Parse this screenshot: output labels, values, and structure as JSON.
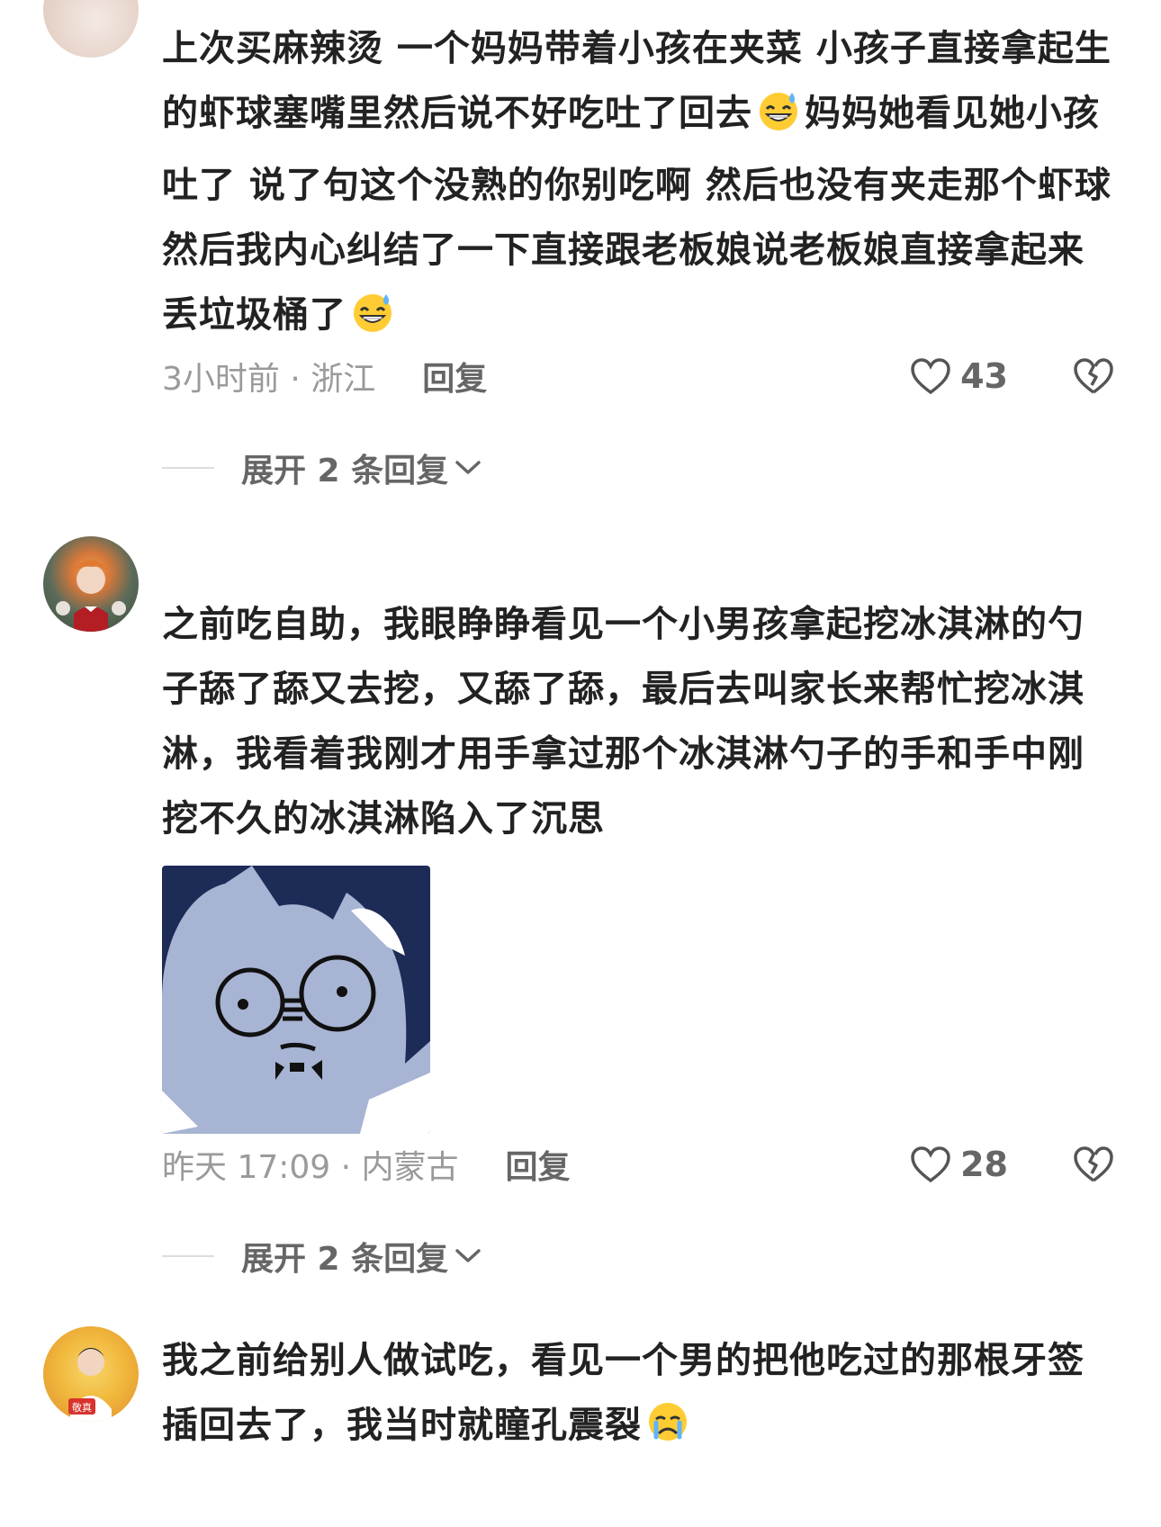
{
  "comments": [
    {
      "text_parts": [
        "上次买麻辣烫 一个妈妈带着小孩在夹菜 小孩子直接拿起生的虾球塞嘴里然后说不好吃吐了回去",
        "妈妈她看见她小孩吐了 说了句这个没熟的你别吃啊 然后也没有夹走那个虾球 然后我内心纠结了一下直接跟老板娘说老板娘直接拿起来丢垃圾桶了"
      ],
      "meta": "3小时前 · 浙江",
      "reply_label": "回复",
      "likes": "43",
      "expand_label": "展开 2 条回复",
      "emoji": "grin-sweat-emoji"
    },
    {
      "text": "之前吃自助，我眼睁睁看见一个小男孩拿起挖冰淇淋的勺子舔了舔又去挖，又舔了舔，最后去叫家长来帮忙挖冰淇淋，我看着我刚才用手拿过那个冰淇淋勺子的手和手中刚挖不久的冰淇淋陷入了沉思",
      "meta": "昨天 17:09 · 内蒙古",
      "reply_label": "回复",
      "likes": "28",
      "expand_label": "展开 2 条回复",
      "sticker": "thinking-cat-with-glasses-sticker"
    },
    {
      "text": "我之前给别人做试吃，看见一个男的把他吃过的那根牙签插回去了，我当时就瞳孔震裂",
      "emoji": "crying-emoji",
      "avatar_badge": "敬真"
    }
  ],
  "colors": {
    "text": "#222222",
    "meta": "#9a9a9a",
    "action": "#666666",
    "sticker_bg": "#a8b4d3",
    "sticker_dark": "#1d2b57"
  }
}
